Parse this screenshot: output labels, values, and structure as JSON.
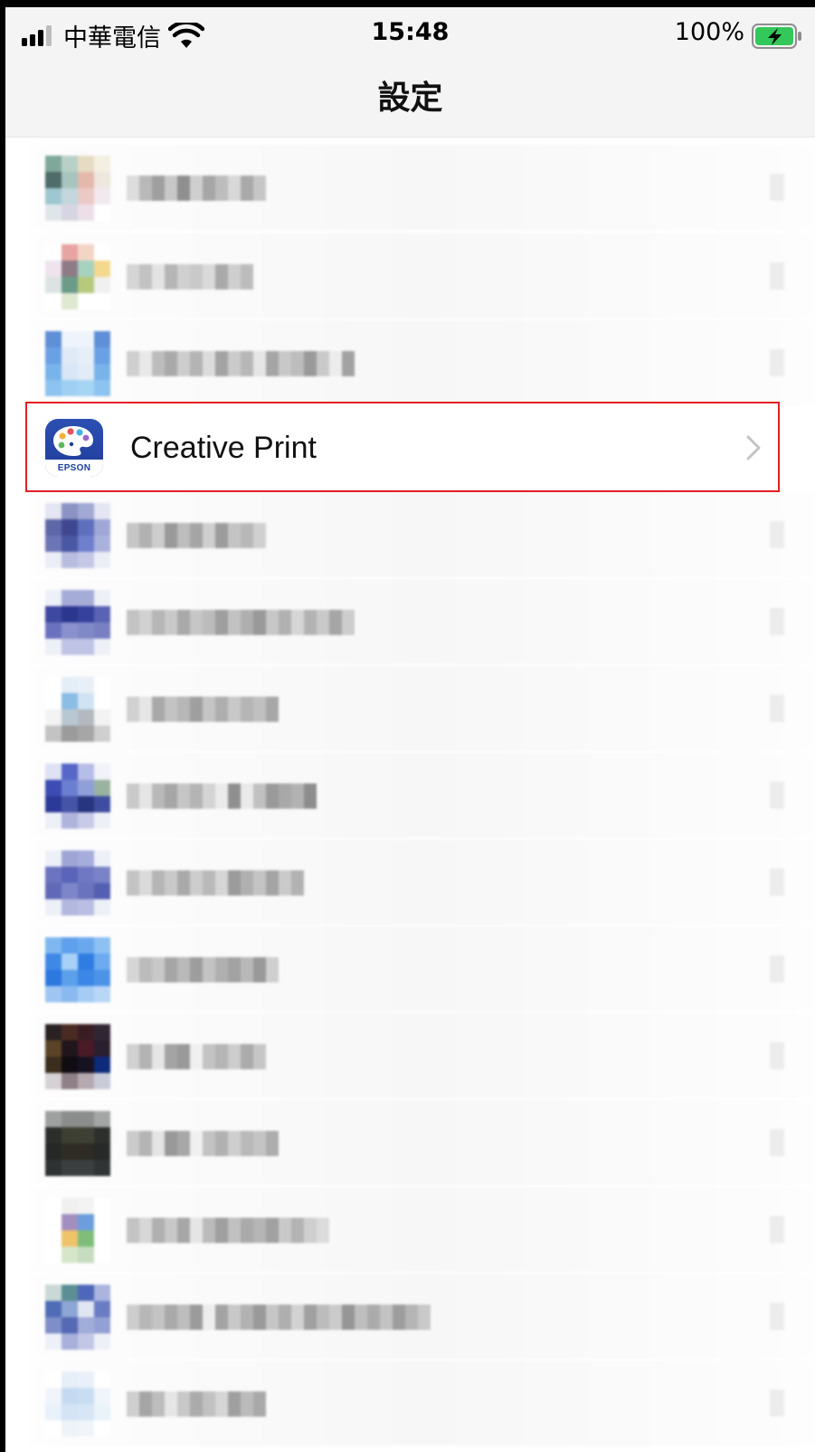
{
  "status_bar": {
    "carrier": "中華電信",
    "time": "15:48",
    "battery_percent": "100%",
    "signal_bars": 3,
    "signal_icon": "cellular-signal-icon",
    "wifi_icon": "wifi-icon",
    "battery_icon": "battery-charging-icon"
  },
  "nav": {
    "title": "設定"
  },
  "highlighted_app": {
    "name": "Creative Print",
    "icon_brand": "EPSON",
    "icon": "epson-creative-print-icon",
    "chevron_icon": "chevron-right-icon"
  },
  "colors": {
    "highlight_border": "#e21f26",
    "bar_background": "#f4f4f4",
    "chevron": "#c4c4c7"
  }
}
